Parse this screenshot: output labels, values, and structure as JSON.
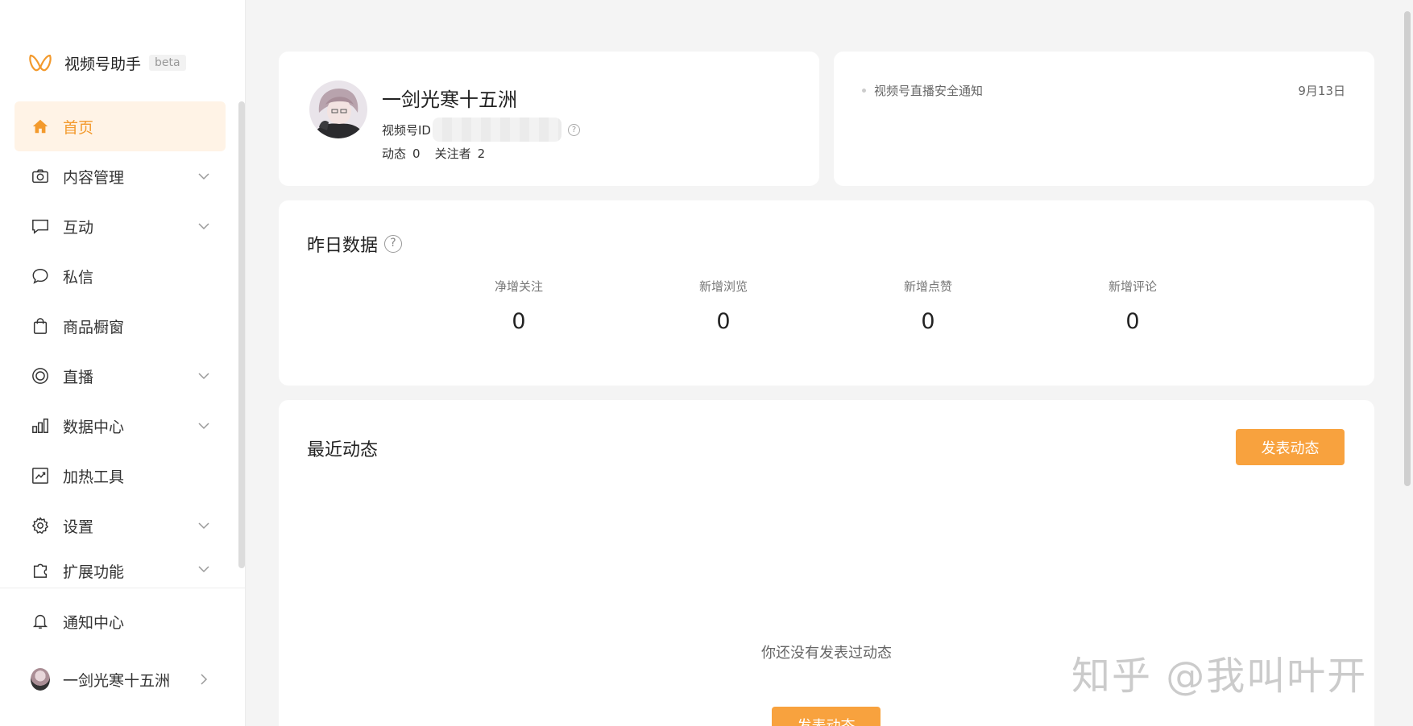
{
  "brand": {
    "name": "视频号助手",
    "badge": "beta"
  },
  "sidebar": {
    "items": [
      {
        "label": "首页",
        "icon": "home-icon",
        "active": true
      },
      {
        "label": "内容管理",
        "icon": "camera-icon",
        "expandable": true
      },
      {
        "label": "互动",
        "icon": "message-square-icon",
        "expandable": true
      },
      {
        "label": "私信",
        "icon": "chat-bubble-icon"
      },
      {
        "label": "商品橱窗",
        "icon": "shopping-bag-icon"
      },
      {
        "label": "直播",
        "icon": "live-circle-icon",
        "expandable": true
      },
      {
        "label": "数据中心",
        "icon": "bar-chart-icon",
        "expandable": true
      },
      {
        "label": "加热工具",
        "icon": "trend-chart-icon"
      },
      {
        "label": "设置",
        "icon": "gear-icon",
        "expandable": true
      },
      {
        "label": "扩展功能",
        "icon": "puzzle-icon",
        "expandable": true
      }
    ],
    "notifications_label": "通知中心",
    "account_name": "一剑光寒十五洲"
  },
  "profile": {
    "name": "一剑光寒十五洲",
    "id_label": "视频号ID",
    "posts_label": "动态",
    "posts_count": "0",
    "followers_label": "关注者",
    "followers_count": "2"
  },
  "notice": {
    "title": "视频号直播安全通知",
    "date": "9月13日"
  },
  "yesterday": {
    "title": "昨日数据",
    "stats": [
      {
        "label": "净增关注",
        "value": "0"
      },
      {
        "label": "新增浏览",
        "value": "0"
      },
      {
        "label": "新增点赞",
        "value": "0"
      },
      {
        "label": "新增评论",
        "value": "0"
      }
    ]
  },
  "recent": {
    "title": "最近动态",
    "post_button": "发表动态",
    "empty_text": "你还没有发表过动态",
    "empty_button": "发表动态"
  },
  "watermark": "知乎 @我叫叶开",
  "colors": {
    "accent": "#f8a23e",
    "active_bg": "#fff3e6",
    "active_text": "#f39a2d",
    "page_bg": "#f4f4f4"
  }
}
